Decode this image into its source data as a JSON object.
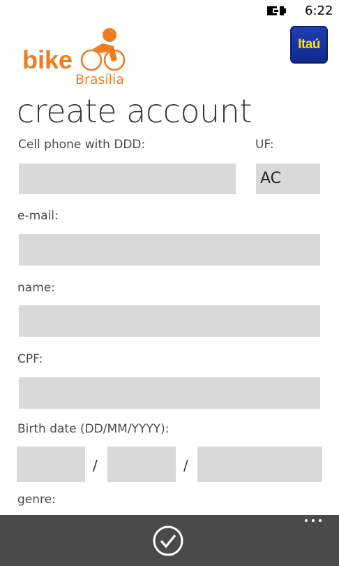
{
  "status": {
    "time": "6:22"
  },
  "branding": {
    "logo_word": "bike",
    "logo_city": "Brasília",
    "bank_name": "Itaú"
  },
  "page": {
    "title": "create account"
  },
  "form": {
    "cell_phone_label": "Cell phone with DDD:",
    "uf_label": "UF:",
    "uf_value": "AC",
    "email_label": "e-mail:",
    "name_label": "name:",
    "cpf_label": "CPF:",
    "birth_label": "Birth date (DD/MM/YYYY):",
    "date_separator": "/",
    "genre_label": "genre:"
  },
  "colors": {
    "accent": "#f07c22",
    "field_bg": "#d9d9d9",
    "app_bar": "#4a4a4a",
    "bank_blue": "#1f3fb3",
    "bank_yellow": "#ffe000"
  },
  "icons": {
    "confirm": "check-circle-icon",
    "more": "ellipsis-icon",
    "battery": "battery-charging-icon"
  }
}
